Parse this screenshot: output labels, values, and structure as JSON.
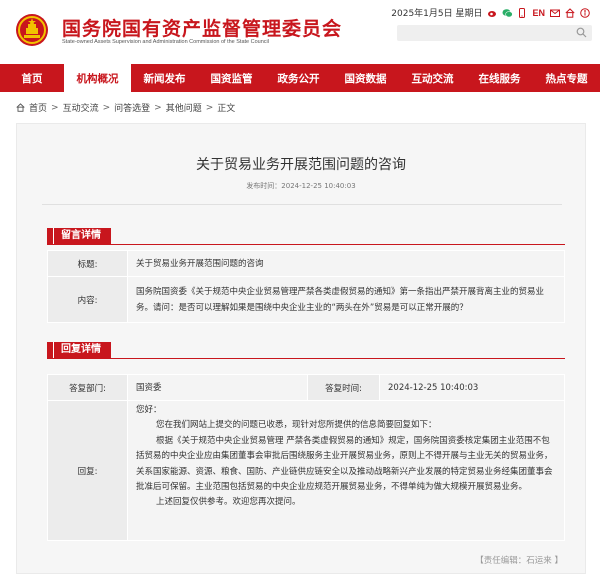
{
  "header": {
    "site_name": "国务院国有资产监督管理委员会",
    "site_sub": "State-owned Assets Supervision and Administration Commission of the State Council",
    "date_text": "2025年1月5日 星期日",
    "en_label": "EN",
    "search_placeholder": ""
  },
  "nav": {
    "items": [
      {
        "label": "首页"
      },
      {
        "label": "机构概况"
      },
      {
        "label": "新闻发布"
      },
      {
        "label": "国资监管"
      },
      {
        "label": "政务公开"
      },
      {
        "label": "国资数据"
      },
      {
        "label": "互动交流"
      },
      {
        "label": "在线服务"
      },
      {
        "label": "热点专题"
      }
    ]
  },
  "breadcrumb": [
    "首页",
    "互动交流",
    "问答选登",
    "其他问题",
    "正文"
  ],
  "article": {
    "title": "关于贸易业务开展范围问题的咨询",
    "pub_time": "发布时间：2024-12-25 10:40:03"
  },
  "message": {
    "section_label": "留言详情",
    "title_key": "标题:",
    "title_value": "关于贸易业务开展范围问题的咨询",
    "content_key": "内容:",
    "content_value": "国务院国资委《关于规范中央企业贸易管理严禁各类虚假贸易的通知》第一条指出严禁开展背离主业的贸易业务。请问：是否可以理解如果是围绕中央企业主业的“两头在外”贸易是可以正常开展的？"
  },
  "reply": {
    "section_label": "回复详情",
    "dept_key": "答复部门:",
    "dept_value": "国资委",
    "time_key": "答复时间:",
    "time_value": "2024-12-25 10:40:03",
    "body_key": "回复:",
    "greeting": "您好：",
    "p1": "您在我们网站上提交的问题已收悉，现针对您所提供的信息简要回复如下：",
    "p2": "根据《关于规范中央企业贸易管理 严禁各类虚假贸易的通知》规定，国务院国资委核定集团主业范围不包括贸易的中央企业应由集团董事会审批后围绕服务主业开展贸易业务，原则上不得开展与主业无关的贸易业务，关系国家能源、资源、粮食、国防、产业链供应链安全以及推动战略新兴产业发展的特定贸易业务经集团董事会批准后可保留。主业范围包括贸易的中央企业应规范开展贸易业务，不得单纯为做大规模开展贸易业务。",
    "p3": "上述回复仅供参考。欢迎您再次提问。"
  },
  "editor": "【责任编辑：石运来 】",
  "colors": {
    "brand_red": "#c8161d"
  }
}
